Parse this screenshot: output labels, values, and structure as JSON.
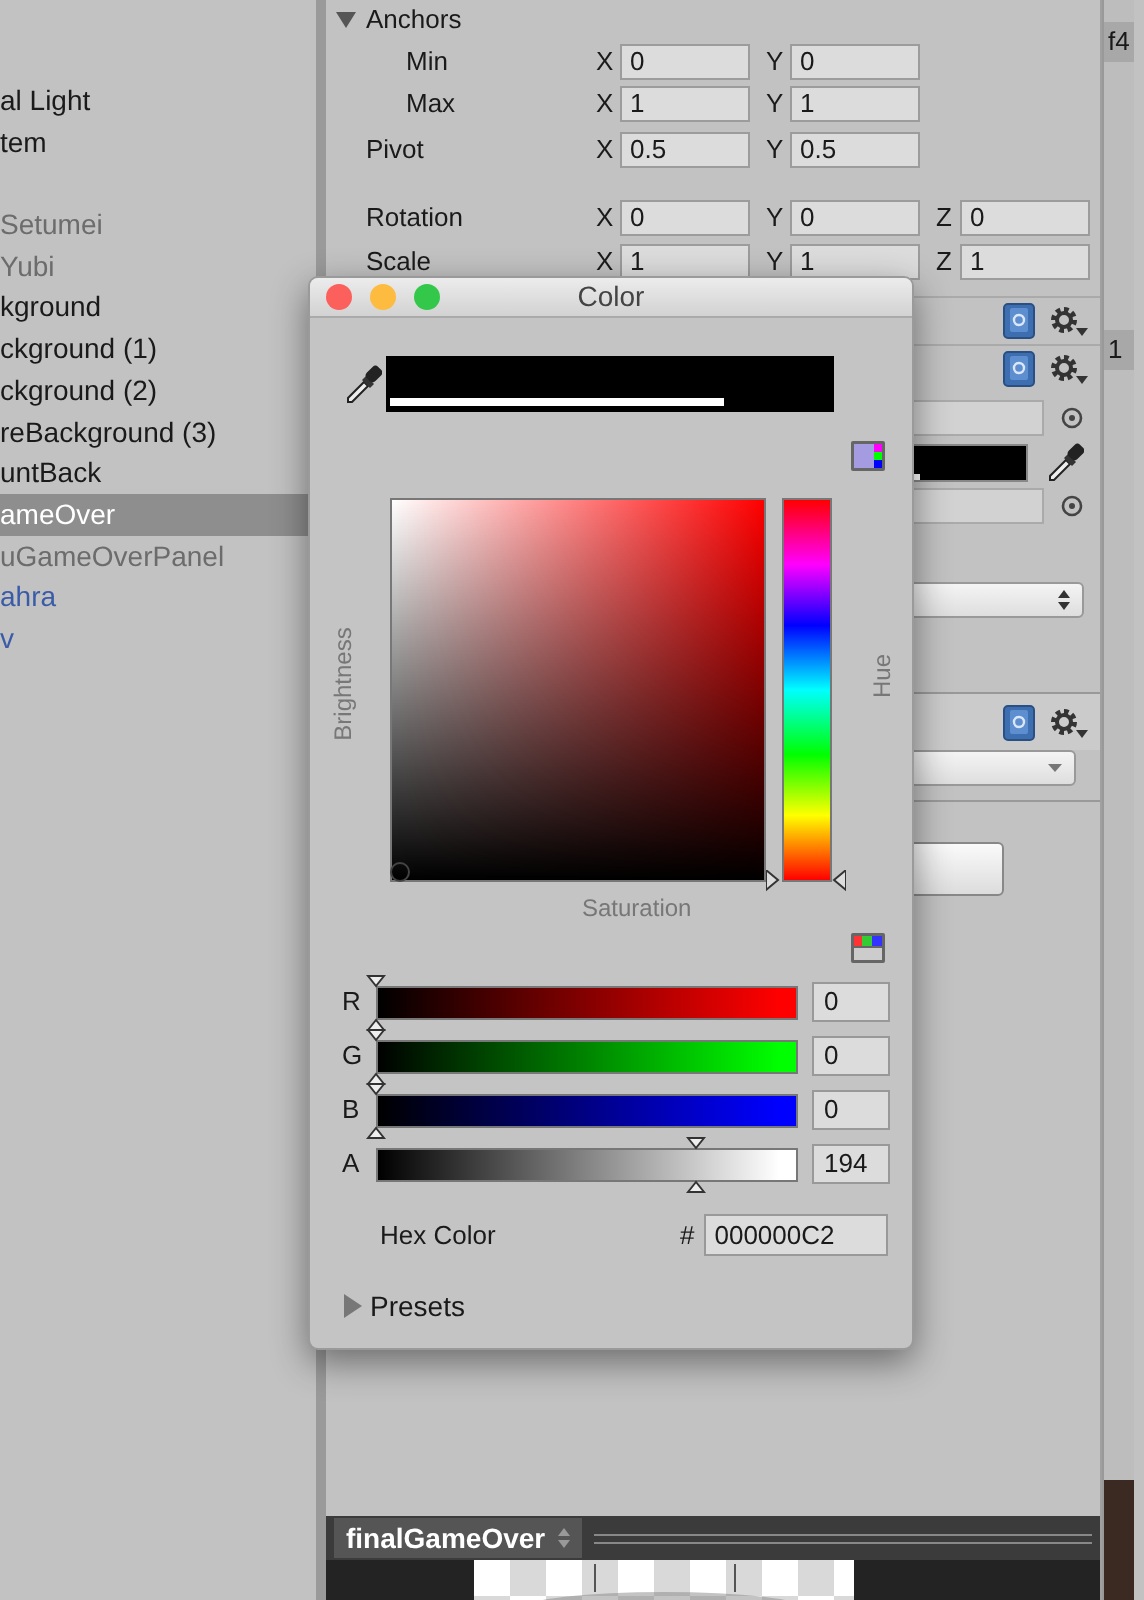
{
  "hierarchy": {
    "items": [
      {
        "label": "al Light",
        "kind": "normal",
        "selected": false
      },
      {
        "label": "tem",
        "kind": "normal",
        "selected": false
      },
      {
        "label": "Setumei",
        "kind": "inactive",
        "selected": false
      },
      {
        "label": "Yubi",
        "kind": "inactive",
        "selected": false
      },
      {
        "label": "kground",
        "kind": "normal",
        "selected": false
      },
      {
        "label": "ckground (1)",
        "kind": "normal",
        "selected": false
      },
      {
        "label": "ckground (2)",
        "kind": "normal",
        "selected": false
      },
      {
        "label": "reBackground (3)",
        "kind": "normal",
        "selected": false
      },
      {
        "label": "untBack",
        "kind": "normal",
        "selected": false
      },
      {
        "label": "ameOver",
        "kind": "normal",
        "selected": true
      },
      {
        "label": "uGameOverPanel",
        "kind": "inactive",
        "selected": false
      },
      {
        "label": "ahra",
        "kind": "prefab",
        "selected": false
      },
      {
        "label": "v",
        "kind": "prefab",
        "selected": false
      }
    ]
  },
  "inspector": {
    "anchors": {
      "label": "Anchors",
      "expanded": true,
      "rows": [
        {
          "label": "Min",
          "fields": [
            {
              "axis": "X",
              "value": "0"
            },
            {
              "axis": "Y",
              "value": "0"
            }
          ]
        },
        {
          "label": "Max",
          "fields": [
            {
              "axis": "X",
              "value": "1"
            },
            {
              "axis": "Y",
              "value": "1"
            }
          ]
        }
      ]
    },
    "rows": [
      {
        "label": "Pivot",
        "fields": [
          {
            "axis": "X",
            "value": "0.5"
          },
          {
            "axis": "Y",
            "value": "0.5"
          }
        ]
      },
      {
        "label": "Rotation",
        "fields": [
          {
            "axis": "X",
            "value": "0"
          },
          {
            "axis": "Y",
            "value": "0"
          },
          {
            "axis": "Z",
            "value": "0"
          }
        ]
      },
      {
        "label": "Scale",
        "fields": [
          {
            "axis": "X",
            "value": "1"
          },
          {
            "axis": "Y",
            "value": "1"
          },
          {
            "axis": "Z",
            "value": "1"
          }
        ]
      }
    ],
    "color_field": {
      "level": 0.76
    }
  },
  "side_tabs": [
    "f4",
    "1"
  ],
  "preview_bar": {
    "object": "finalGameOver"
  },
  "color_window": {
    "title": "Color",
    "window_buttons": [
      {
        "color": "#fc605c"
      },
      {
        "color": "#fdbc40"
      },
      {
        "color": "#34c84a"
      }
    ],
    "preview": {
      "level": 0.76
    },
    "brightness": {
      "label": "Brightness",
      "level": 0
    },
    "saturation": {
      "label": "Saturation",
      "level": 0
    },
    "hue": {
      "label": "Hue",
      "level": 0
    },
    "sliders": [
      {
        "label": "R",
        "color": "#ff0000",
        "level": 0,
        "value": "0"
      },
      {
        "label": "G",
        "color": "#00ff00",
        "level": 0,
        "value": "0"
      },
      {
        "label": "B",
        "color": "#0000ff",
        "level": 0,
        "value": "0"
      },
      {
        "label": "A",
        "color": "#ffffff",
        "level": 0.76,
        "value": "194"
      }
    ],
    "hex": {
      "label": "Hex Color",
      "prefix": "#",
      "value": "000000C2"
    },
    "presets": {
      "label": "Presets",
      "expanded": false
    }
  }
}
